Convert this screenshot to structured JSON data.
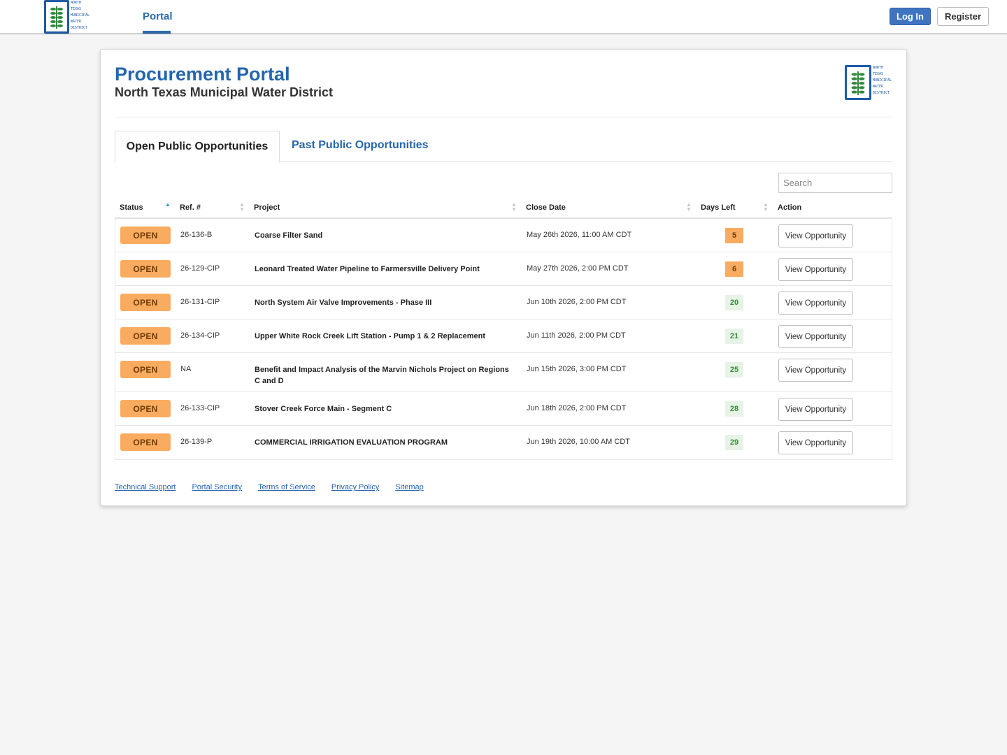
{
  "header": {
    "logo_lines": [
      "NORTH",
      "TEXAS",
      "MUNICIPAL",
      "WATER",
      "DISTRICT"
    ],
    "nav_portal": "Portal",
    "login_label": "Log In",
    "register_label": "Register"
  },
  "main": {
    "title": "Procurement Portal",
    "subtitle": "North Texas Municipal Water District",
    "tabs": [
      {
        "label": "Open Public Opportunities",
        "active": true
      },
      {
        "label": "Past Public Opportunities",
        "active": false
      }
    ],
    "search_placeholder": "Search"
  },
  "table": {
    "columns": [
      "Status",
      "Ref. #",
      "Project",
      "Close Date",
      "Days Left",
      "Action"
    ],
    "rows": [
      {
        "status": "OPEN",
        "ref": "26-136-B",
        "project": "Coarse Filter Sand",
        "close_date": "May 26th 2026, 11:00 AM CDT",
        "days_left": "5",
        "action": "View Opportunity"
      },
      {
        "status": "OPEN",
        "ref": "26-129-CIP",
        "project": "Leonard Treated Water Pipeline to Farmersville Delivery Point",
        "close_date": "May 27th 2026, 2:00 PM CDT",
        "days_left": "6",
        "action": "View Opportunity"
      },
      {
        "status": "OPEN",
        "ref": "26-131-CIP",
        "project": "North System Air Valve Improvements - Phase III",
        "close_date": "Jun 10th 2026, 2:00 PM CDT",
        "days_left": "20",
        "action": "View Opportunity"
      },
      {
        "status": "OPEN",
        "ref": "26-134-CIP",
        "project": "Upper White Rock Creek Lift Station - Pump 1 & 2 Replacement",
        "close_date": "Jun 11th 2026, 2:00 PM CDT",
        "days_left": "21",
        "action": "View Opportunity"
      },
      {
        "status": "OPEN",
        "ref": "NA",
        "project": "Benefit and Impact Analysis of the Marvin Nichols Project on Regions C and D",
        "close_date": "Jun 15th 2026, 3:00 PM CDT",
        "days_left": "25",
        "action": "View Opportunity"
      },
      {
        "status": "OPEN",
        "ref": "26-133-CIP",
        "project": "Stover Creek Force Main - Segment C",
        "close_date": "Jun 18th 2026, 2:00 PM CDT",
        "days_left": "28",
        "action": "View Opportunity"
      },
      {
        "status": "OPEN",
        "ref": "26-139-P",
        "project": "COMMERCIAL IRRIGATION EVALUATION PROGRAM",
        "close_date": "Jun 19th 2026, 10:00 AM CDT",
        "days_left": "29",
        "action": "View Opportunity"
      }
    ]
  },
  "footer": {
    "links": [
      "Technical Support",
      "Portal Security",
      "Terms of Service",
      "Privacy Policy",
      "Sitemap"
    ]
  },
  "colors": {
    "brand_blue": "#2565ae",
    "open_badge": "#f9ac60",
    "days_ok_bg": "#e6f3e6"
  }
}
